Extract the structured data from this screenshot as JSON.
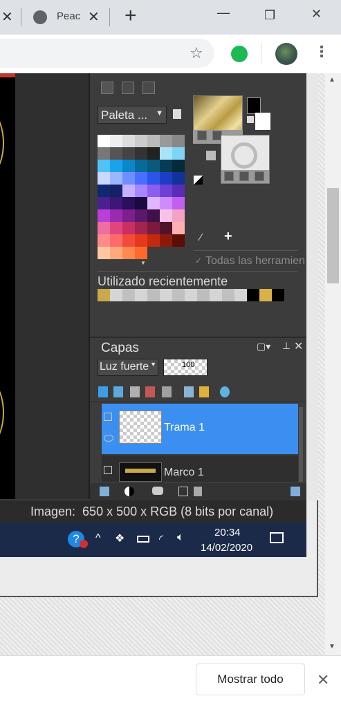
{
  "browser": {
    "tab_close_glyph": "✕",
    "tab_title": "Peac",
    "new_tab_glyph": "+",
    "window_controls": {
      "minimize": "—",
      "restore": "❐",
      "close": "✕"
    },
    "bookmark_icon": "star-icon",
    "menu_glyph": "⋮"
  },
  "psp": {
    "palette_dropdown": "Paleta ...",
    "all_tools_label": "Todas las herramien",
    "recent_label": "Utilizado recientemente",
    "palette_colors": [
      "#ffffff",
      "#eeeeee",
      "#dddddd",
      "#cccccc",
      "#bbbbbb",
      "#999999",
      "#888888",
      "#777777",
      "#555555",
      "#444444",
      "#333333",
      "#222222",
      "#a8e4f7",
      "#7fd3f5",
      "#4fc3f7",
      "#1aa3ea",
      "#0b86c9",
      "#066a9c",
      "#0c5a7a",
      "#083b54",
      "#062a3c",
      "#c9d8ff",
      "#9bb6ff",
      "#6e8fff",
      "#4a6fff",
      "#2c54e6",
      "#1c3ec2",
      "#12329a",
      "#0e2a6e",
      "#142266",
      "#c7b0ff",
      "#a786ff",
      "#8c5ef0",
      "#6f3fd8",
      "#5a2db8",
      "#4b1f90",
      "#3d1676",
      "#2a0f5c",
      "#1a0a40",
      "#e2b5ff",
      "#d08aff",
      "#c25ef0",
      "#b93fd6",
      "#9a2bb0",
      "#7b208c",
      "#5c186a",
      "#401048",
      "#f5c3e8",
      "#f5a1c6",
      "#ec6f9f",
      "#e0467d",
      "#c92f62",
      "#a42450",
      "#7a1a3e",
      "#52122a",
      "#ffb0b0",
      "#ff8b8b",
      "#ff6a6a",
      "#f44a3e",
      "#e33a1c",
      "#c22a10",
      "#8c1a0a",
      "#5a0e06",
      "#ffc7a0",
      "#ffaa7a",
      "#ff8a50",
      "#ff6a2a"
    ],
    "recent_swatches": [
      "#caa94a",
      "#d5d5d5",
      "#c0c0c0",
      "#d5d5d5",
      "#bdbdbd",
      "#d5d5d5",
      "#c0c0c0",
      "#d5d5d5",
      "#bdbdbd",
      "#d5d5d5",
      "#c0c0c0",
      "#d5d5d5",
      "#000000",
      "#d9b14a",
      "#000000"
    ],
    "layers_title": "Capas",
    "blend_mode": "Luz fuerte",
    "opacity_value": "100",
    "layers": [
      {
        "name": "Trama 1",
        "selected": true
      },
      {
        "name": "Marco 1",
        "selected": false
      }
    ],
    "status_text": "Imagen:  650 x 500 x RGB (8 bits por canal)"
  },
  "taskbar": {
    "time": "20:34",
    "date": "14/02/2020",
    "help_glyph": "?"
  },
  "download_bar": {
    "show_all_label": "Mostrar todo",
    "close_glyph": "✕"
  },
  "colors": {
    "chrome_tab_strip": "#dee1e6",
    "psp_dark": "#3c3c3c",
    "selected_layer": "#3b8ff0",
    "taskbar": "#1b2a48",
    "gold_accent": "#c9a74a"
  }
}
